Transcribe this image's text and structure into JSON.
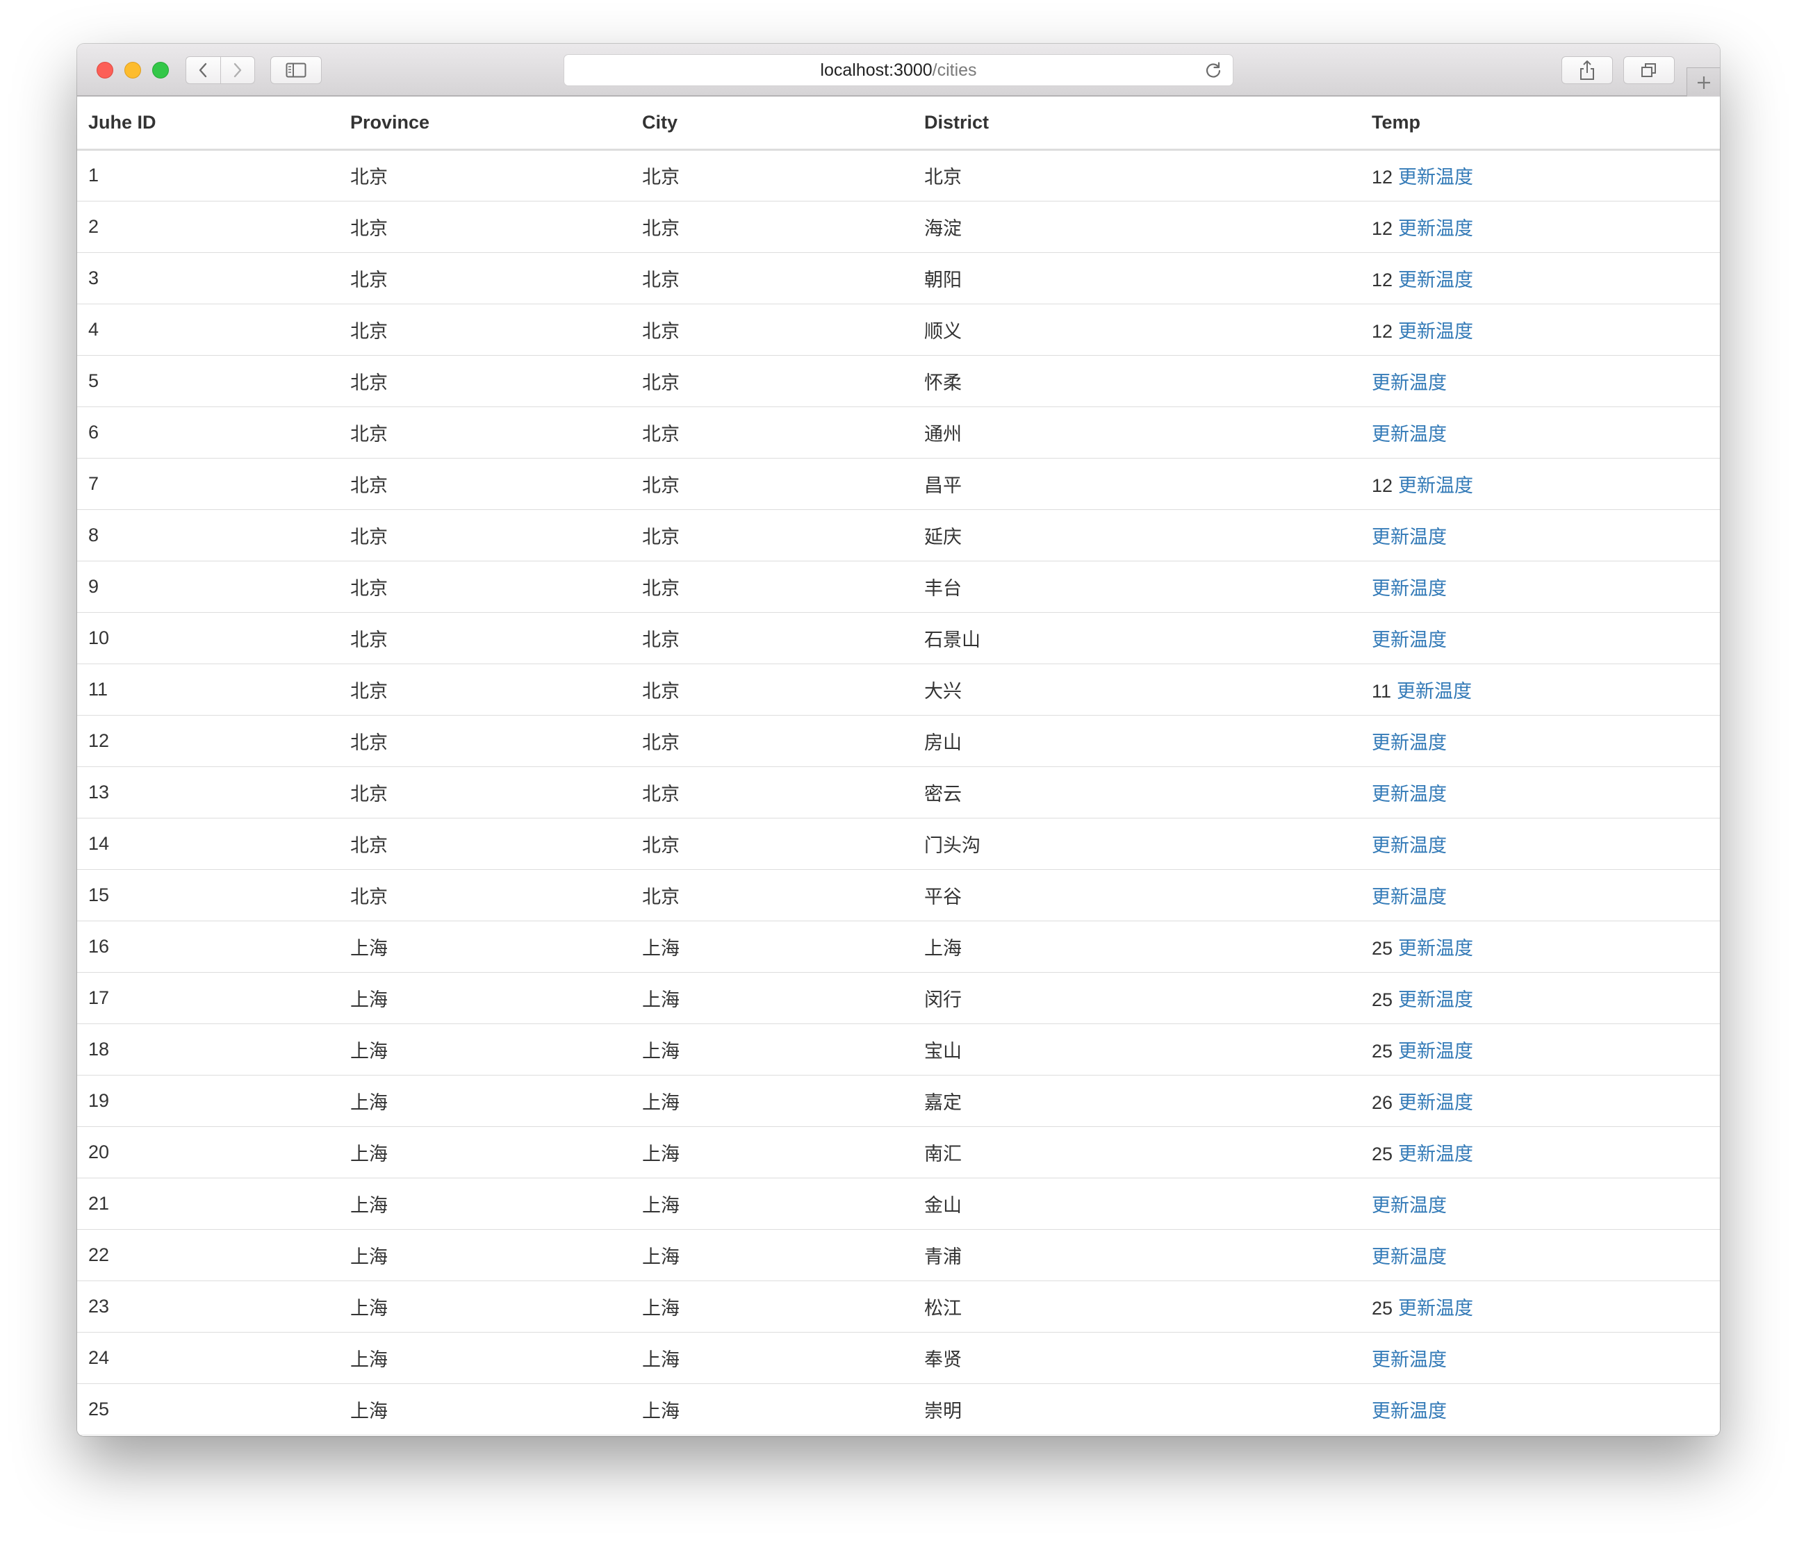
{
  "browser": {
    "address_host": "localhost:3000",
    "address_path": "/cities"
  },
  "table": {
    "headers": [
      "Juhe ID",
      "Province",
      "City",
      "District",
      "Temp"
    ],
    "link_label": "更新温度",
    "rows": [
      {
        "id": "1",
        "province": "北京",
        "city": "北京",
        "district": "北京",
        "temp": "12"
      },
      {
        "id": "2",
        "province": "北京",
        "city": "北京",
        "district": "海淀",
        "temp": "12"
      },
      {
        "id": "3",
        "province": "北京",
        "city": "北京",
        "district": "朝阳",
        "temp": "12"
      },
      {
        "id": "4",
        "province": "北京",
        "city": "北京",
        "district": "顺义",
        "temp": "12"
      },
      {
        "id": "5",
        "province": "北京",
        "city": "北京",
        "district": "怀柔",
        "temp": ""
      },
      {
        "id": "6",
        "province": "北京",
        "city": "北京",
        "district": "通州",
        "temp": ""
      },
      {
        "id": "7",
        "province": "北京",
        "city": "北京",
        "district": "昌平",
        "temp": "12"
      },
      {
        "id": "8",
        "province": "北京",
        "city": "北京",
        "district": "延庆",
        "temp": ""
      },
      {
        "id": "9",
        "province": "北京",
        "city": "北京",
        "district": "丰台",
        "temp": ""
      },
      {
        "id": "10",
        "province": "北京",
        "city": "北京",
        "district": "石景山",
        "temp": ""
      },
      {
        "id": "11",
        "province": "北京",
        "city": "北京",
        "district": "大兴",
        "temp": "11"
      },
      {
        "id": "12",
        "province": "北京",
        "city": "北京",
        "district": "房山",
        "temp": ""
      },
      {
        "id": "13",
        "province": "北京",
        "city": "北京",
        "district": "密云",
        "temp": ""
      },
      {
        "id": "14",
        "province": "北京",
        "city": "北京",
        "district": "门头沟",
        "temp": ""
      },
      {
        "id": "15",
        "province": "北京",
        "city": "北京",
        "district": "平谷",
        "temp": ""
      },
      {
        "id": "16",
        "province": "上海",
        "city": "上海",
        "district": "上海",
        "temp": "25"
      },
      {
        "id": "17",
        "province": "上海",
        "city": "上海",
        "district": "闵行",
        "temp": "25"
      },
      {
        "id": "18",
        "province": "上海",
        "city": "上海",
        "district": "宝山",
        "temp": "25"
      },
      {
        "id": "19",
        "province": "上海",
        "city": "上海",
        "district": "嘉定",
        "temp": "26"
      },
      {
        "id": "20",
        "province": "上海",
        "city": "上海",
        "district": "南汇",
        "temp": "25"
      },
      {
        "id": "21",
        "province": "上海",
        "city": "上海",
        "district": "金山",
        "temp": ""
      },
      {
        "id": "22",
        "province": "上海",
        "city": "上海",
        "district": "青浦",
        "temp": ""
      },
      {
        "id": "23",
        "province": "上海",
        "city": "上海",
        "district": "松江",
        "temp": "25"
      },
      {
        "id": "24",
        "province": "上海",
        "city": "上海",
        "district": "奉贤",
        "temp": ""
      },
      {
        "id": "25",
        "province": "上海",
        "city": "上海",
        "district": "崇明",
        "temp": ""
      }
    ]
  },
  "icons": {
    "close": "close-icon",
    "minimize": "minimize-icon",
    "maximize": "maximize-icon",
    "back": "chevron-left-icon",
    "forward": "chevron-right-icon",
    "sidebar": "sidebar-icon",
    "reload": "reload-icon",
    "share": "share-icon",
    "tabs": "tabs-overview-icon",
    "new_tab": "plus-icon"
  },
  "colors": {
    "link": "#337ab7",
    "text": "#333333",
    "border": "#dddddd"
  }
}
